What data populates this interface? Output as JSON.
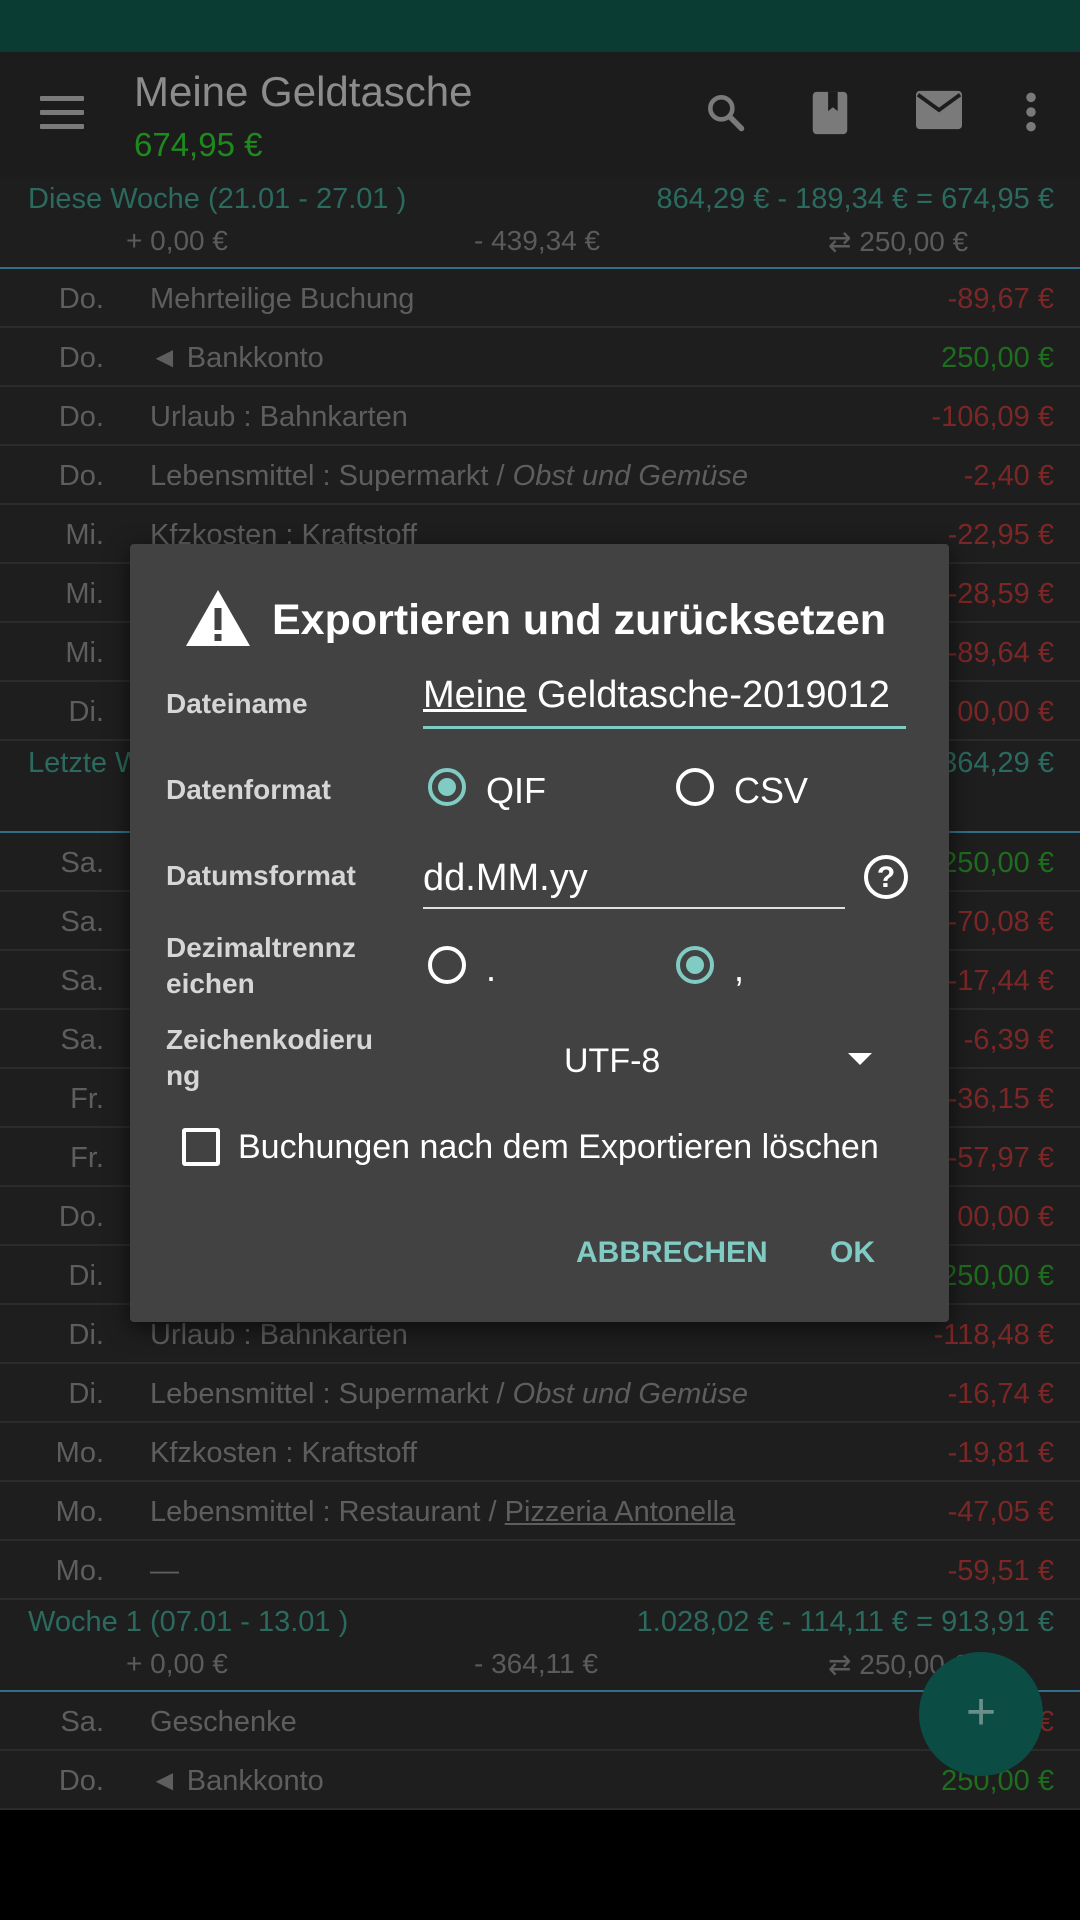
{
  "app_bar": {
    "title": "Meine Geldtasche",
    "balance": "674,95 €",
    "icons": [
      "menu-icon",
      "search-icon",
      "bookmark-icon",
      "mail-icon",
      "more-vert-icon"
    ]
  },
  "weeks": [
    {
      "title": "Diese Woche (21.01 - 27.01 )",
      "summary": "864,29 € - 189,34 € = 674,95 €",
      "income": "+ 0,00 €",
      "expense": "- 439,34 €",
      "transfer": "⇄ 250,00 €",
      "rows": [
        {
          "day": "Do.",
          "desc": "Mehrteilige Buchung",
          "amount": "-89,67 €",
          "sign": "neg"
        },
        {
          "day": "Do.",
          "desc": "◄ Bankkonto",
          "amount": "250,00 €",
          "sign": "pos"
        },
        {
          "day": "Do.",
          "desc": "Urlaub : Bahnkarten",
          "amount": "-106,09 €",
          "sign": "neg"
        },
        {
          "day": "Do.",
          "desc": "Lebensmittel : Supermarkt / ",
          "note": "Obst und Gemüse",
          "amount": "-2,40 €",
          "sign": "neg"
        },
        {
          "day": "Mi.",
          "desc": "Kfzkosten : Kraftstoff",
          "amount": "-22,95 €",
          "sign": "neg"
        },
        {
          "day": "Mi.",
          "desc": "",
          "amount": "-28,59 €",
          "sign": "neg"
        },
        {
          "day": "Mi.",
          "desc": "",
          "amount": "-89,64 €",
          "sign": "neg"
        },
        {
          "day": "Di.",
          "desc": "",
          "amount": "00,00 €",
          "sign": "neg"
        }
      ]
    },
    {
      "title": "Letzte W",
      "summary": "364,29 €",
      "income": "",
      "expense": "",
      "transfer": "0 €",
      "rows": [
        {
          "day": "Sa.",
          "desc": "",
          "amount": "250,00 €",
          "sign": "pos"
        },
        {
          "day": "Sa.",
          "desc": "",
          "amount": "-70,08 €",
          "sign": "neg"
        },
        {
          "day": "Sa.",
          "desc": "",
          "amount": "-17,44 €",
          "sign": "neg"
        },
        {
          "day": "Sa.",
          "desc": "",
          "amount": "-6,39 €",
          "sign": "neg"
        },
        {
          "day": "Fr.",
          "desc": "",
          "amount": "-36,15 €",
          "sign": "neg"
        },
        {
          "day": "Fr.",
          "desc": "",
          "amount": "-57,97 €",
          "sign": "neg"
        },
        {
          "day": "Do.",
          "desc": "",
          "amount": "00,00 €",
          "sign": "neg"
        },
        {
          "day": "Di.",
          "desc": "",
          "amount": "250,00 €",
          "sign": "pos"
        },
        {
          "day": "Di.",
          "desc": "Urlaub : Bahnkarten",
          "amount": "-118,48 €",
          "sign": "neg"
        },
        {
          "day": "Di.",
          "desc": "Lebensmittel : Supermarkt / ",
          "note": "Obst und Gemüse",
          "amount": "-16,74 €",
          "sign": "neg"
        },
        {
          "day": "Mo.",
          "desc": "Kfzkosten : Kraftstoff",
          "amount": "-19,81 €",
          "sign": "neg"
        },
        {
          "day": "Mo.",
          "desc": "Lebensmittel : Restaurant / ",
          "link": "Pizzeria Antonella",
          "amount": "-47,05 €",
          "sign": "neg"
        },
        {
          "day": "Mo.",
          "desc": "—",
          "amount": "-59,51 €",
          "sign": "neg"
        }
      ]
    },
    {
      "title": "Woche 1 (07.01 - 13.01 )",
      "summary": "1.028,02 € - 114,11 € = 913,91 €",
      "income": "+ 0,00 €",
      "expense": "- 364,11 €",
      "transfer": "⇄ 250,00 €",
      "rows": [
        {
          "day": "Sa.",
          "desc": "Geschenke",
          "amount": "€",
          "sign": "neg"
        },
        {
          "day": "Do.",
          "desc": "◄ Bankkonto",
          "amount": "250,00 €",
          "sign": "pos"
        }
      ]
    }
  ],
  "dialog": {
    "title": "Exportieren und zurücksetzen",
    "icon": "warning-icon",
    "filename_label": "Dateiname",
    "filename_first": "Meine",
    "filename_rest": " Geldtasche-2019012",
    "format_label": "Datenformat",
    "format_options": [
      "QIF",
      "CSV"
    ],
    "format_selected": "QIF",
    "date_label": "Datumsformat",
    "date_value": "dd.MM.yy",
    "decimal_label": "Dezimaltrennzeichen",
    "decimal_label_l1": "Dezimaltrennz",
    "decimal_label_l2": "eichen",
    "decimal_options": [
      ".",
      ","
    ],
    "decimal_selected": ",",
    "encoding_label": "Zeichenkodierung",
    "encoding_label_l1": "Zeichenkodieru",
    "encoding_label_l2": "ng",
    "encoding_value": "UTF-8",
    "delete_checkbox_label": "Buchungen nach dem Exportieren löschen",
    "delete_checked": false,
    "cancel_label": "ABBRECHEN",
    "ok_label": "OK"
  },
  "colors": {
    "accent": "#80cbc4",
    "status_bar": "#0a3c34",
    "negative": "#c62828",
    "positive": "#2e7d32",
    "dialog_bg": "#424242"
  }
}
